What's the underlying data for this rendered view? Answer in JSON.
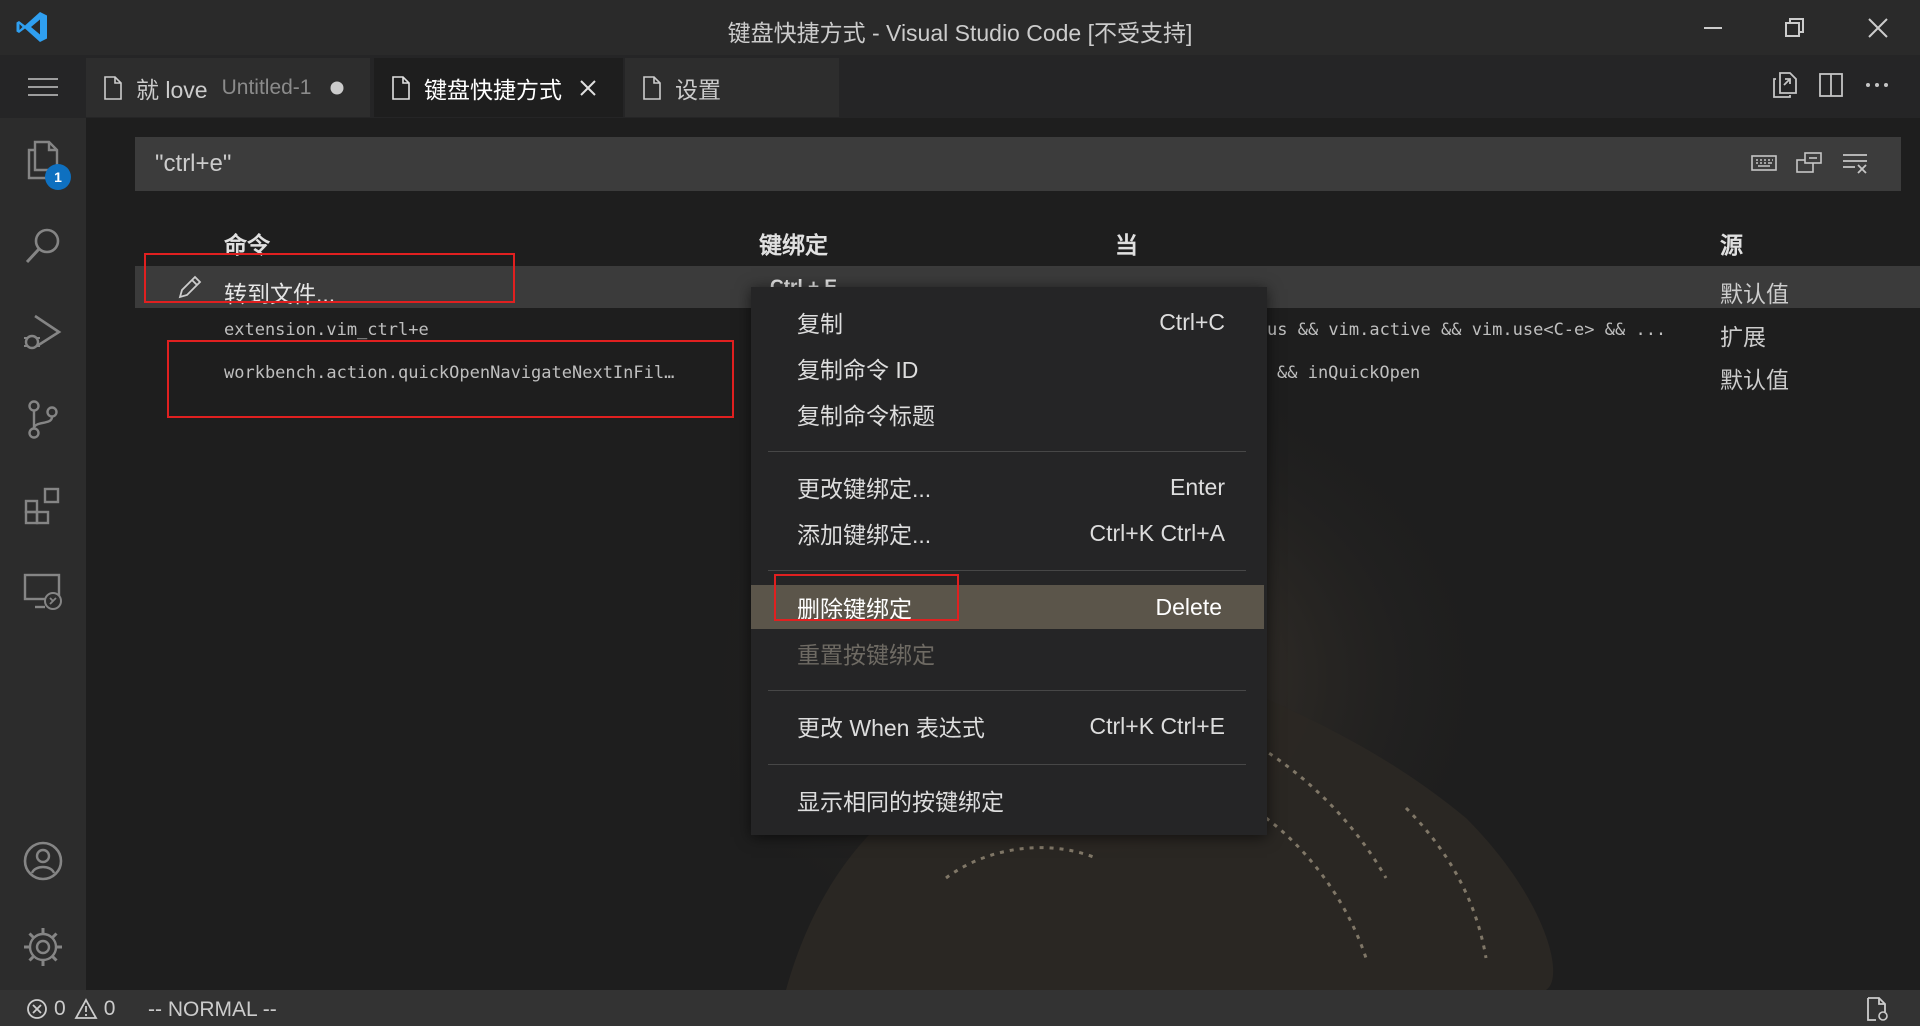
{
  "window": {
    "title": "键盘快捷方式 - Visual Studio Code [不受支持]"
  },
  "tabs": [
    {
      "label": "就 love",
      "sub": "Untitled-1",
      "state": "dirty"
    },
    {
      "label": "键盘快捷方式",
      "state": "active"
    },
    {
      "label": "设置"
    }
  ],
  "activity": {
    "explorer_badge": "1"
  },
  "search": {
    "value": "\"ctrl+e\""
  },
  "table": {
    "headers": {
      "command": "命令",
      "keybinding": "键绑定",
      "when": "当",
      "source": "源"
    },
    "rows": [
      {
        "command": "转到文件...",
        "keybinding": "Ctrl + E",
        "when": "",
        "source": "默认值"
      },
      {
        "command": "extension.vim_ctrl+e",
        "keybinding": "",
        "when": "us && vim.active && vim.use<C-e> && ...",
        "source": "扩展"
      },
      {
        "command": "workbench.action.quickOpenNavigateNextInFil…",
        "keybinding": "",
        "when": "&& inQuickOpen",
        "source": "默认值"
      }
    ]
  },
  "context_menu": {
    "items": [
      {
        "label": "复制",
        "shortcut": "Ctrl+C"
      },
      {
        "label": "复制命令 ID",
        "shortcut": ""
      },
      {
        "label": "复制命令标题",
        "shortcut": ""
      },
      {
        "label": "更改键绑定...",
        "shortcut": "Enter"
      },
      {
        "label": "添加键绑定...",
        "shortcut": "Ctrl+K Ctrl+A"
      },
      {
        "label": "删除键绑定",
        "shortcut": "Delete"
      },
      {
        "label": "重置按键绑定",
        "shortcut": ""
      },
      {
        "label": "更改 When 表达式",
        "shortcut": "Ctrl+K Ctrl+E"
      },
      {
        "label": "显示相同的按键绑定",
        "shortcut": ""
      }
    ]
  },
  "status": {
    "errors": "0",
    "warnings": "0",
    "mode": "-- NORMAL --"
  },
  "colors": {
    "accent": "#0e70c0",
    "highlight_box": "#e02020",
    "menu_selected": "#5b554a"
  }
}
